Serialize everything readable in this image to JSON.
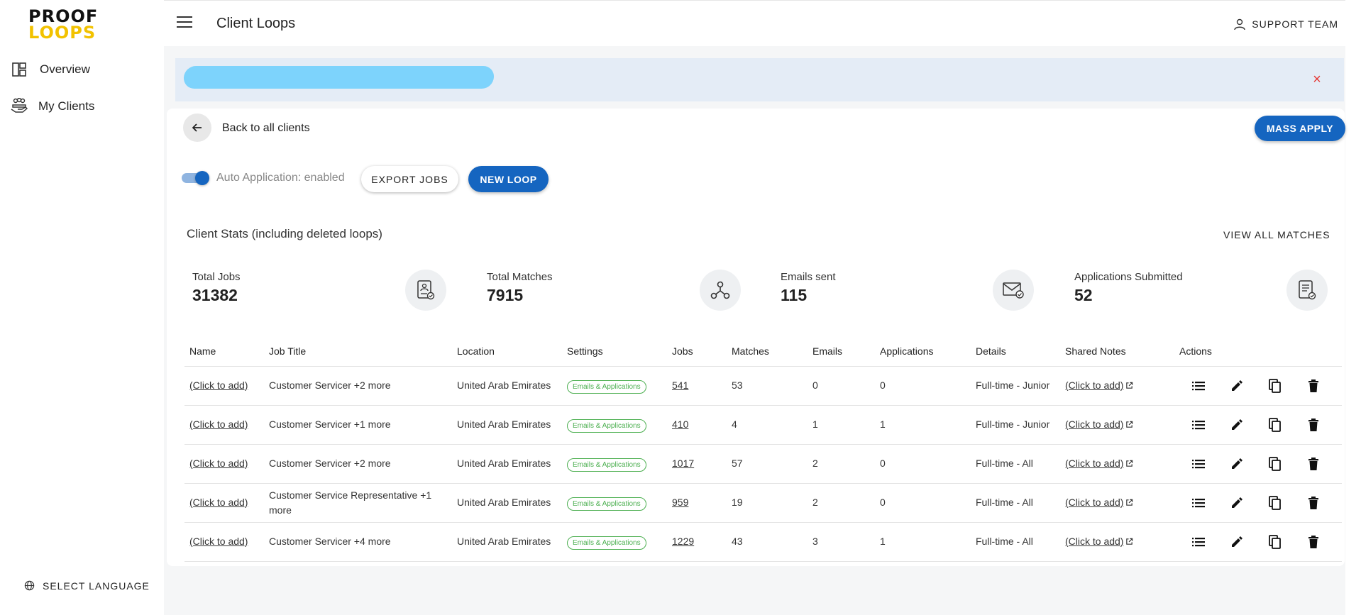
{
  "sidebar": {
    "logo_line1": "PROOF",
    "logo_line2": "LOOPS",
    "items": [
      {
        "label": "Overview",
        "icon": "dashboard-icon"
      },
      {
        "label": "My Clients",
        "icon": "clients-hand-icon"
      }
    ],
    "language_label": "SELECT LANGUAGE"
  },
  "header": {
    "title": "Client Loops",
    "user_label": "SUPPORT TEAM"
  },
  "banner": {
    "close_glyph": "×"
  },
  "toolbar": {
    "back_label": "Back to all clients",
    "mass_apply_label": "MASS APPLY",
    "auto_application_label": "Auto Application: enabled",
    "auto_application_enabled": true,
    "export_label": "EXPORT JOBS",
    "new_loop_label": "NEW LOOP"
  },
  "stats": {
    "title": "Client Stats (including deleted loops)",
    "view_all_label": "VIEW ALL MATCHES",
    "items": [
      {
        "label": "Total Jobs",
        "value": "31382",
        "icon": "jobs-document-icon"
      },
      {
        "label": "Total Matches",
        "value": "7915",
        "icon": "network-icon"
      },
      {
        "label": "Emails sent",
        "value": "115",
        "icon": "email-check-icon"
      },
      {
        "label": "Applications Submitted",
        "value": "52",
        "icon": "application-check-icon"
      }
    ]
  },
  "table": {
    "columns": [
      "Name",
      "Job Title",
      "Location",
      "Settings",
      "Jobs",
      "Matches",
      "Emails",
      "Applications",
      "Details",
      "Shared Notes",
      "Actions"
    ],
    "rows": [
      {
        "name": "(Click to add)",
        "job_title": "Customer Servicer +2 more",
        "location": "United Arab Emirates",
        "settings": "Emails & Applications",
        "jobs": "541",
        "matches": "53",
        "emails": "0",
        "applications": "0",
        "details": "Full-time - Junior",
        "notes": "(Click to add)"
      },
      {
        "name": "(Click to add)",
        "job_title": "Customer Servicer +1 more",
        "location": "United Arab Emirates",
        "settings": "Emails & Applications",
        "jobs": "410",
        "matches": "4",
        "emails": "1",
        "applications": "1",
        "details": "Full-time - Junior",
        "notes": "(Click to add)"
      },
      {
        "name": "(Click to add)",
        "job_title": "Customer Servicer +2 more",
        "location": "United Arab Emirates",
        "settings": "Emails & Applications",
        "jobs": "1017",
        "matches": "57",
        "emails": "2",
        "applications": "0",
        "details": "Full-time - All",
        "notes": "(Click to add)"
      },
      {
        "name": "(Click to add)",
        "job_title": "Customer Service Representative +1 more",
        "location": "United Arab Emirates",
        "settings": "Emails & Applications",
        "jobs": "959",
        "matches": "19",
        "emails": "2",
        "applications": "0",
        "details": "Full-time - All",
        "notes": "(Click to add)"
      },
      {
        "name": "(Click to add)",
        "job_title": "Customer Servicer +4 more",
        "location": "United Arab Emirates",
        "settings": "Emails & Applications",
        "jobs": "1229",
        "matches": "43",
        "emails": "3",
        "applications": "1",
        "details": "Full-time - All",
        "notes": "(Click to add)"
      }
    ]
  },
  "colors": {
    "primary": "#1565c0",
    "banner_bg": "#e4ecf6",
    "badge_green": "#4caf50",
    "close_red": "#e53935",
    "logo_yellow": "#f2c200"
  }
}
